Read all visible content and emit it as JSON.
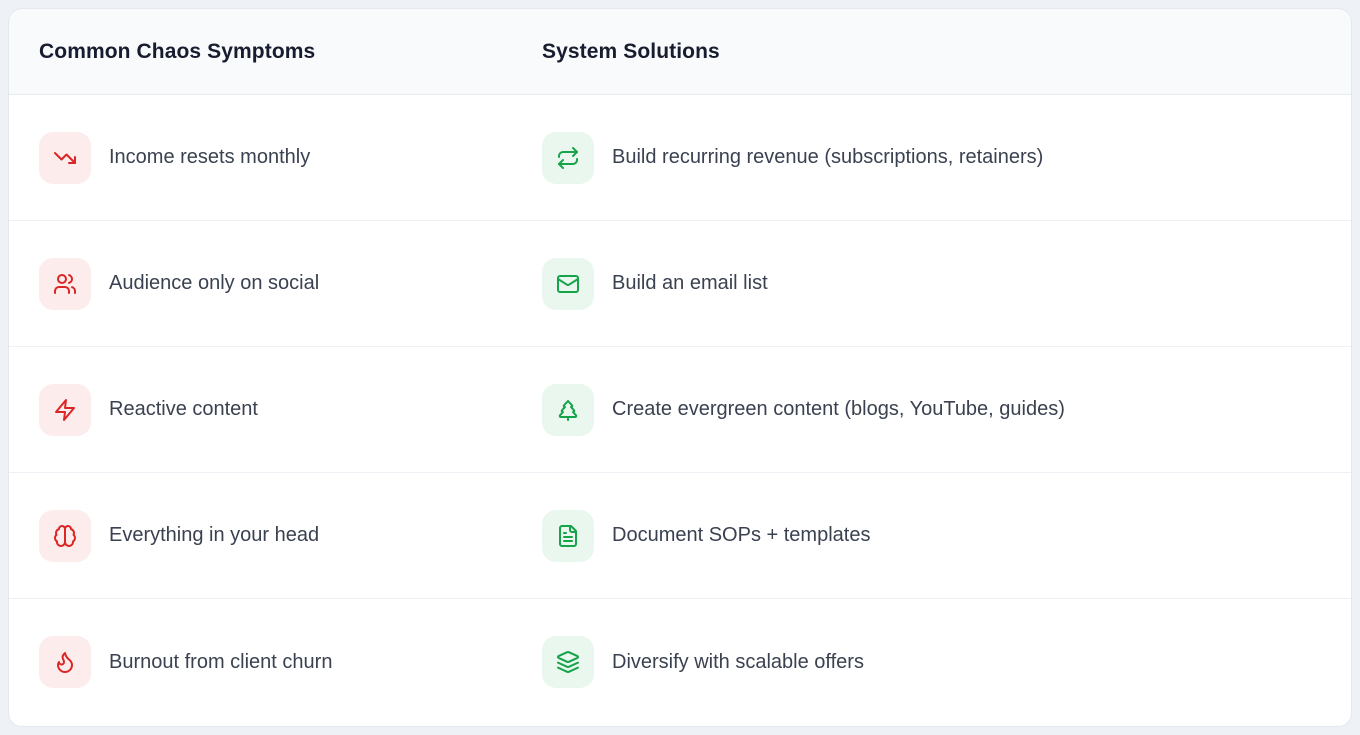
{
  "table": {
    "headers": {
      "symptoms": "Common Chaos Symptoms",
      "solutions": "System Solutions"
    },
    "rows": [
      {
        "symptom": {
          "icon": "trending-down-icon",
          "label": "Income resets monthly"
        },
        "solution": {
          "icon": "repeat-icon",
          "label": "Build recurring revenue (subscriptions, retainers)"
        }
      },
      {
        "symptom": {
          "icon": "users-icon",
          "label": "Audience only on social"
        },
        "solution": {
          "icon": "mail-icon",
          "label": "Build an email list"
        }
      },
      {
        "symptom": {
          "icon": "lightning-icon",
          "label": "Reactive content"
        },
        "solution": {
          "icon": "evergreen-tree-icon",
          "label": "Create evergreen content (blogs, YouTube, guides)"
        }
      },
      {
        "symptom": {
          "icon": "brain-icon",
          "label": "Everything in your head"
        },
        "solution": {
          "icon": "document-icon",
          "label": "Document SOPs + templates"
        }
      },
      {
        "symptom": {
          "icon": "flame-icon",
          "label": "Burnout from client churn"
        },
        "solution": {
          "icon": "layers-icon",
          "label": "Diversify with scalable offers"
        }
      }
    ]
  },
  "chart_data": {
    "type": "table",
    "columns": [
      "Common Chaos Symptoms",
      "System Solutions"
    ],
    "rows": [
      [
        "Income resets monthly",
        "Build recurring revenue (subscriptions, retainers)"
      ],
      [
        "Audience only on social",
        "Build an email list"
      ],
      [
        "Reactive content",
        "Create evergreen content (blogs, YouTube, guides)"
      ],
      [
        "Everything in your head",
        "Document SOPs + templates"
      ],
      [
        "Burnout from client churn",
        "Diversify with scalable offers"
      ]
    ]
  },
  "colors": {
    "symptom_icon": "#dc2626",
    "symptom_icon_bg": "#fdecec",
    "solution_icon": "#16a34a",
    "solution_icon_bg": "#e9f7ee",
    "header_text": "#171c2e",
    "row_text": "#3a4150",
    "header_bg": "#f8fafc",
    "card_bg": "#ffffff",
    "page_bg": "#eef2f7",
    "divider": "#edf0f4"
  }
}
